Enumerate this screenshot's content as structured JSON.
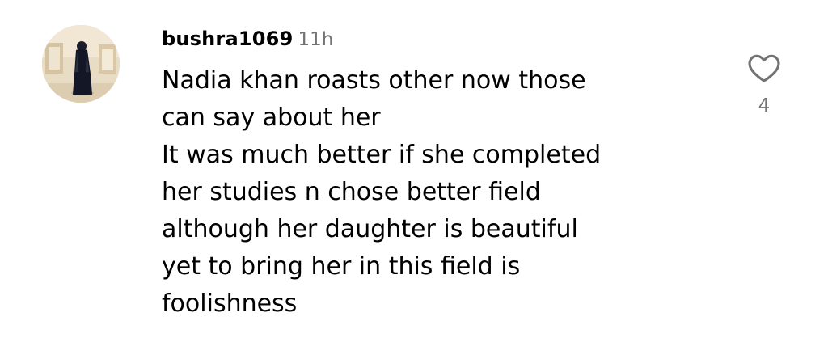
{
  "comment": {
    "username": "bushra1069",
    "timestamp": "11h",
    "lines": [
      "Nadia khan roasts other now those",
      "can say about her",
      "It was much better if she completed",
      "her studies n chose better field",
      "although her daughter is beautiful",
      "yet to bring her in this field is",
      "foolishness"
    ],
    "like_icon": "heart-outline-icon",
    "like_count": "4"
  },
  "colors": {
    "text": "#000000",
    "muted": "#737373",
    "background": "#ffffff"
  }
}
